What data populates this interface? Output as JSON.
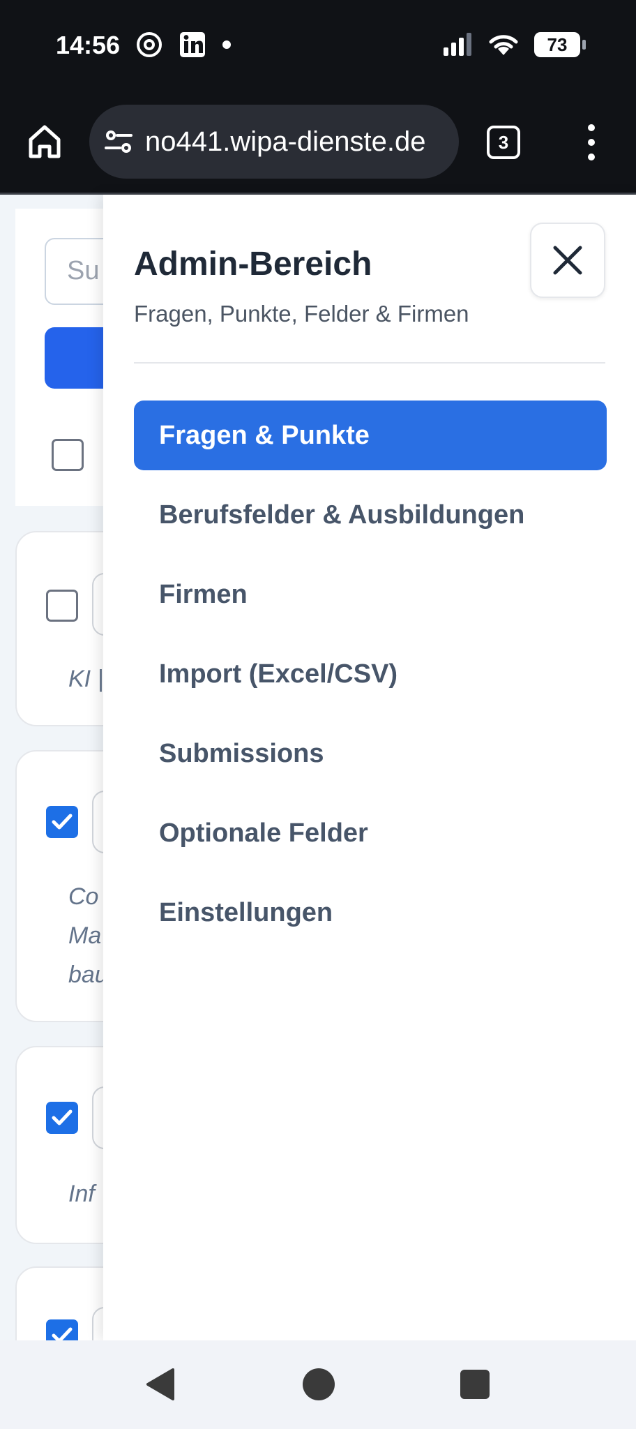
{
  "status_bar": {
    "time": "14:56",
    "battery": "73",
    "icons": [
      "threads-icon",
      "linkedin-icon",
      "dot-icon",
      "signal-icon",
      "wifi-icon",
      "battery-icon"
    ]
  },
  "browser": {
    "url": "no441.wipa-dienste.de",
    "tab_count": "3"
  },
  "background_page": {
    "search_placeholder": "Su",
    "card_texts": {
      "card1_line1": "KI |",
      "card2_line1": "Co",
      "card2_line2": "Ma",
      "card2_line3": "bau",
      "card3_line1": "Inf"
    }
  },
  "drawer": {
    "title": "Admin-Bereich",
    "subtitle": "Fragen, Punkte, Felder & Firmen",
    "nav": [
      {
        "label": "Fragen & Punkte",
        "active": true
      },
      {
        "label": "Berufsfelder & Ausbildungen",
        "active": false
      },
      {
        "label": "Firmen",
        "active": false
      },
      {
        "label": "Import (Excel/CSV)",
        "active": false
      },
      {
        "label": "Submissions",
        "active": false
      },
      {
        "label": "Optionale Felder",
        "active": false
      },
      {
        "label": "Einstellungen",
        "active": false
      }
    ]
  },
  "colors": {
    "accent": "#2a6fe3",
    "checkbox": "#1d6fe6",
    "system_bar": "#101216"
  }
}
